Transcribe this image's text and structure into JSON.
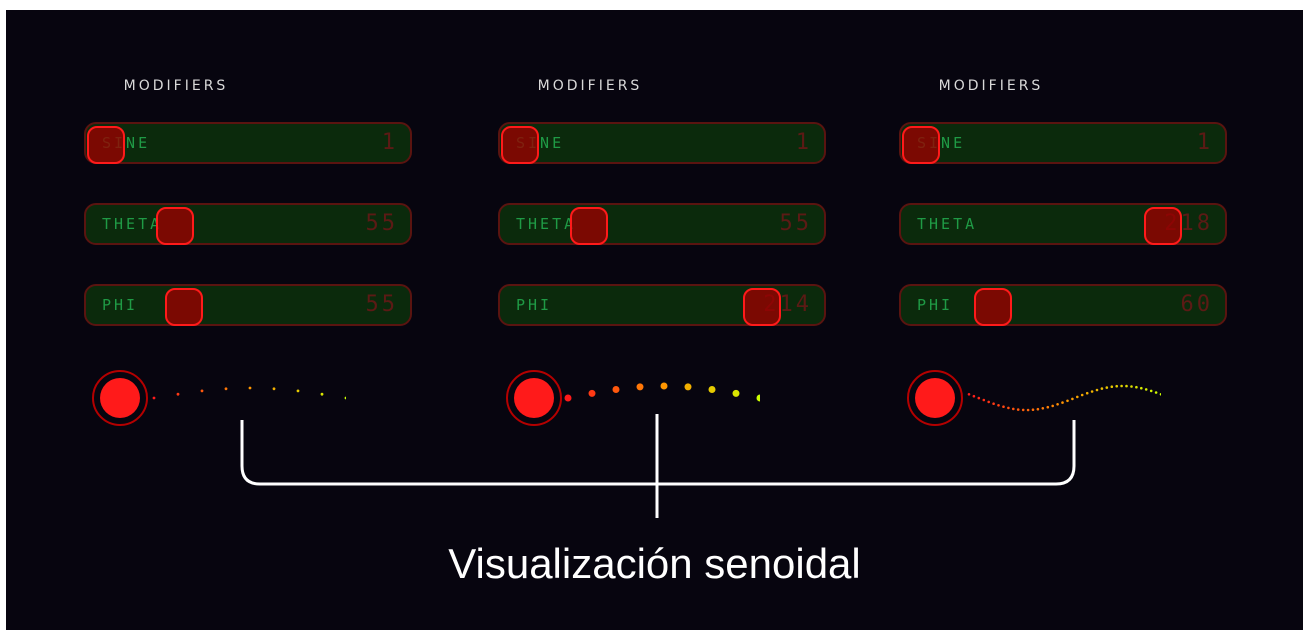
{
  "panels": [
    {
      "title": "MODIFIERS",
      "sliders": [
        {
          "label": "SINE",
          "value": "1",
          "level": 0.0
        },
        {
          "label": "THETA",
          "value": "55",
          "level": 0.24
        },
        {
          "label": "PHI",
          "value": "55",
          "level": 0.27
        }
      ],
      "wave": {
        "dots": 9,
        "amplitude": 10,
        "style": "sparse"
      }
    },
    {
      "title": "MODIFIERS",
      "sliders": [
        {
          "label": "SINE",
          "value": "1",
          "level": 0.0
        },
        {
          "label": "THETA",
          "value": "55",
          "level": 0.24
        },
        {
          "label": "PHI",
          "value": "214",
          "level": 0.84
        }
      ],
      "wave": {
        "dots": 9,
        "amplitude": 12,
        "style": "large"
      }
    },
    {
      "title": "MODIFIERS",
      "sliders": [
        {
          "label": "SINE",
          "value": "1",
          "level": 0.0
        },
        {
          "label": "THETA",
          "value": "218",
          "level": 0.84
        },
        {
          "label": "PHI",
          "value": "60",
          "level": 0.25
        }
      ],
      "wave": {
        "dots": 40,
        "amplitude": 12,
        "style": "dense"
      }
    }
  ],
  "caption": "Visualización senoidal",
  "colors": {
    "background": "#07050f",
    "start_node": "#ff1a1a",
    "end_node": "#ccff00",
    "label_green": "#1f9a45",
    "value_red": "#5c1a15"
  }
}
